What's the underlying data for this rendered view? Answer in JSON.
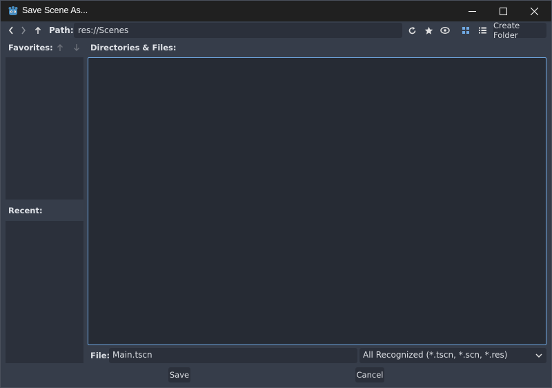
{
  "window": {
    "title": "Save Scene As..."
  },
  "toolbar": {
    "path_label": "Path:",
    "path_value": "res://Scenes",
    "create_folder_label": "Create Folder"
  },
  "sidebar": {
    "favorites_label": "Favorites:",
    "recent_label": "Recent:"
  },
  "main": {
    "files_label": "Directories & Files:"
  },
  "footer": {
    "file_label": "File:",
    "file_value": "Main.tscn",
    "filter_value": "All Recognized (*.tscn, *.scn, *.res)",
    "save_label": "Save",
    "cancel_label": "Cancel"
  },
  "colors": {
    "accent": "#70a9e3",
    "panel": "#2b303b",
    "background": "#363d4a"
  }
}
